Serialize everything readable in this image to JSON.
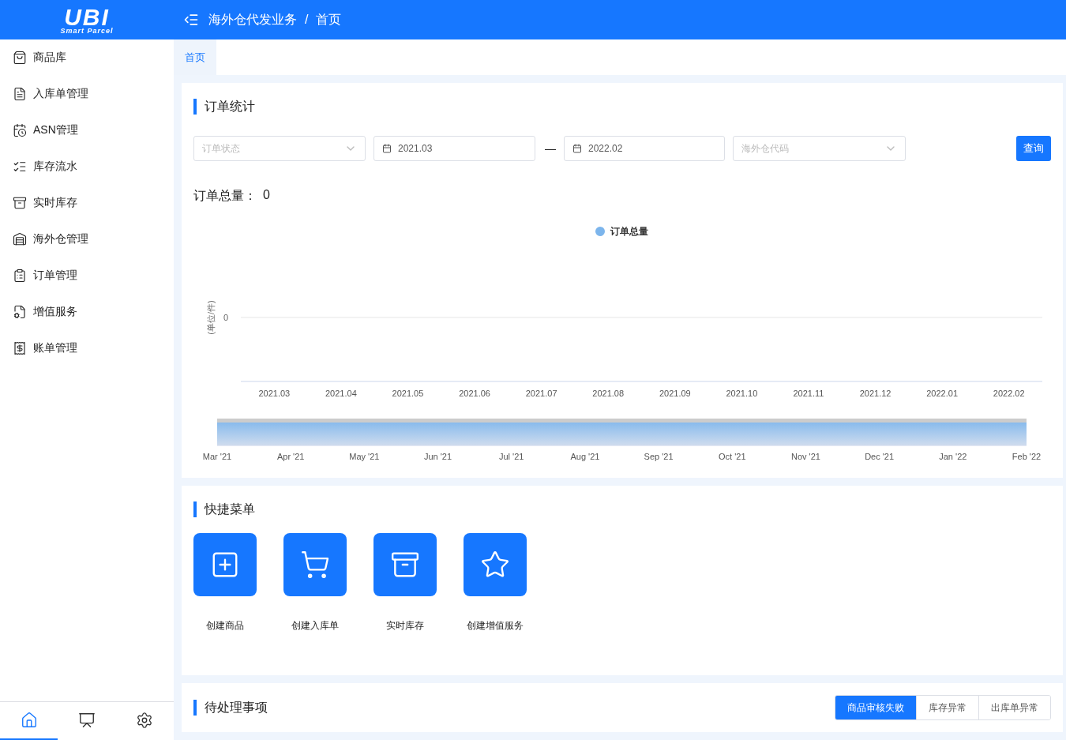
{
  "header": {
    "logo_text": "UBI",
    "logo_subtitle": "Smart Parcel",
    "breadcrumb": [
      "海外仓代发业务",
      "首页"
    ],
    "separator": "/"
  },
  "sidebar": {
    "items": [
      {
        "label": "商品库",
        "selected": false
      },
      {
        "label": "入库单管理",
        "selected": false
      },
      {
        "label": "ASN管理",
        "selected": false
      },
      {
        "label": "库存流水",
        "selected": false
      },
      {
        "label": "实时库存",
        "selected": false
      },
      {
        "label": "海外仓管理",
        "selected": false
      },
      {
        "label": "订单管理",
        "selected": false
      },
      {
        "label": "增值服务",
        "selected": false
      },
      {
        "label": "账单管理",
        "selected": false
      }
    ],
    "bottom_tabs": [
      {
        "selected": true
      },
      {
        "selected": false
      },
      {
        "selected": false
      }
    ]
  },
  "tabs": [
    {
      "label": "首页",
      "selected": true
    }
  ],
  "order_stats": {
    "title": "订单统计",
    "filters": {
      "status": {
        "placeholder": "订单状态"
      },
      "date_from": {
        "value": "2021.03"
      },
      "range_separator": "—",
      "date_to": {
        "value": "2022.02"
      },
      "warehouse": {
        "placeholder": "海外仓代码"
      },
      "query_button": "查询"
    },
    "total_label": "订单总量：",
    "total_value": "0",
    "chart": {
      "legend": "订单总量",
      "y_axis_title": "(单位/件)",
      "y_axis_label": "0",
      "x_axis_labels": [
        "2021.03",
        "2021.04",
        "2021.05",
        "2021.06",
        "2021.07",
        "2021.08",
        "2021.09",
        "2021.10",
        "2021.11",
        "2021.12",
        "2022.01",
        "2022.02"
      ]
    },
    "navigator_labels": [
      "Mar '21",
      "Apr '21",
      "May '21",
      "Jun '21",
      "Jul '21",
      "Aug '21",
      "Sep '21",
      "Oct '21",
      "Nov '21",
      "Dec '21",
      "Jan '22",
      "Feb '22"
    ]
  },
  "quick_menu": {
    "title": "快捷菜单",
    "items": [
      {
        "label": "创建商品"
      },
      {
        "label": "创建入库单"
      },
      {
        "label": "实时库存"
      },
      {
        "label": "创建增值服务"
      }
    ]
  },
  "pending": {
    "title": "待处理事项",
    "tabs": [
      {
        "label": "商品审核失败",
        "selected": true
      },
      {
        "label": "库存异常",
        "selected": false
      },
      {
        "label": "出库单异常",
        "selected": false
      }
    ]
  }
}
